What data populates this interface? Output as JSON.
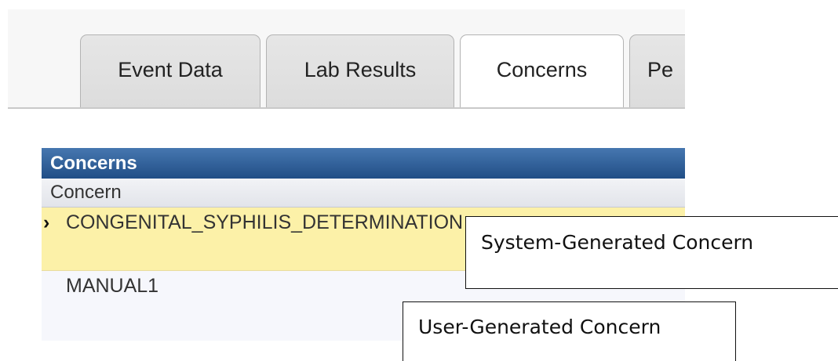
{
  "tabs": [
    {
      "label": "Event Data",
      "active": false
    },
    {
      "label": "Lab Results",
      "active": false
    },
    {
      "label": "Concerns",
      "active": true
    },
    {
      "label": "Pe",
      "active": false
    }
  ],
  "concerns_panel": {
    "title": "Concerns",
    "column_header": "Concern",
    "rows": [
      {
        "marker": "›",
        "value": "CONGENITAL_SYPHILIS_DETERMINATION",
        "selected": true
      },
      {
        "marker": "",
        "value": "MANUAL1",
        "selected": false
      }
    ]
  },
  "callouts": {
    "system": "System-Generated Concern",
    "user": "User-Generated Concern"
  },
  "colors": {
    "panel_header": "#2c5b95",
    "selected_row": "#fcf1a8",
    "tab_inactive": "#e2e2e2",
    "tab_active": "#ffffff"
  }
}
